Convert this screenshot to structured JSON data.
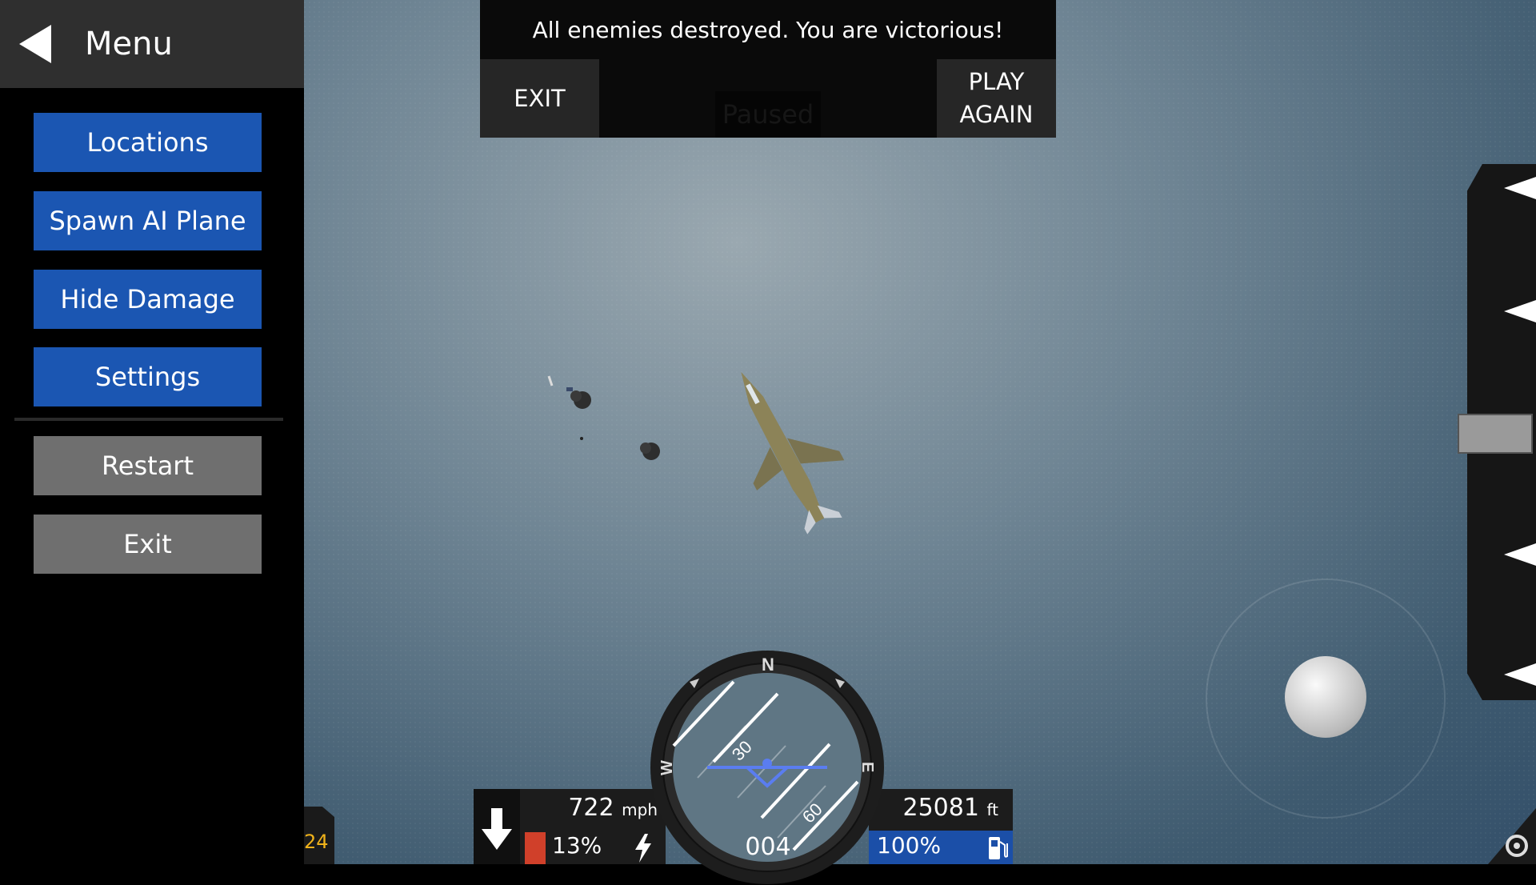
{
  "menu": {
    "title": "Menu",
    "items": [
      {
        "label": "Locations",
        "style": "blue"
      },
      {
        "label": "Spawn AI Plane",
        "style": "blue"
      },
      {
        "label": "Hide Damage",
        "style": "blue"
      },
      {
        "label": "Settings",
        "style": "blue"
      },
      {
        "label": "Restart",
        "style": "gray"
      },
      {
        "label": "Exit",
        "style": "gray"
      }
    ]
  },
  "dialog": {
    "message": "All enemies destroyed. You are victorious!",
    "exit_label": "EXIT",
    "play_again_line1": "PLAY",
    "play_again_line2": "AGAIN",
    "paused_label": "Paused"
  },
  "hud": {
    "speed_value": "722",
    "speed_unit": "mph",
    "throttle_percent": "13%",
    "throttle_fraction": 0.13,
    "altitude_value": "25081",
    "altitude_unit": "ft",
    "fuel_percent": "100%",
    "fuel_fraction": 1.0,
    "heading": "004",
    "level_indicator": "24",
    "compass": {
      "north": "N",
      "east": "E",
      "west": "W",
      "pitch_up": "30",
      "pitch_down": "60"
    }
  },
  "icons": {
    "back": "back-arrow-icon",
    "down": "down-arrow-icon",
    "bolt": "lightning-icon",
    "fuel": "fuel-pump-icon",
    "camera": "camera-view-icon"
  },
  "colors": {
    "menu_blue": "#1b56b2",
    "menu_gray": "#6f6f6f",
    "fuel_blue": "#1b4fa8",
    "throttle_red": "#d0402a",
    "level_orange": "#f0b21a"
  }
}
